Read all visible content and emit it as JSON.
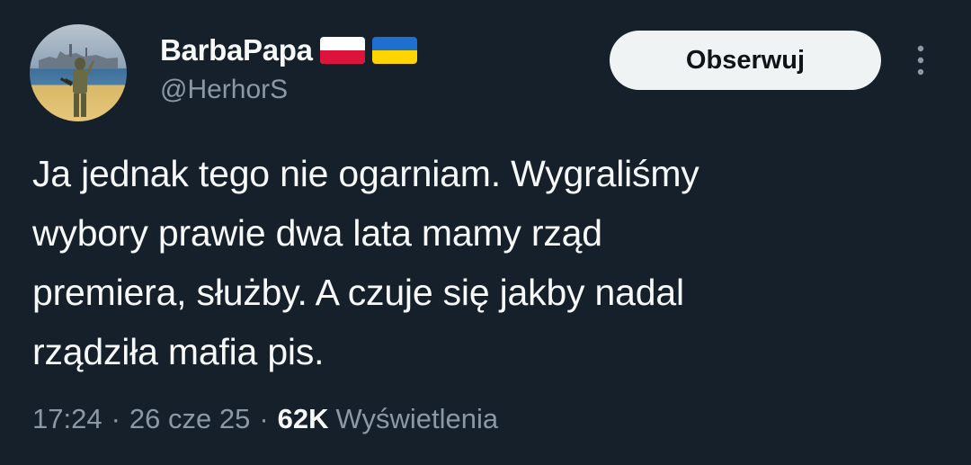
{
  "author": {
    "display_name": "BarbaPapa",
    "handle": "@HerhorS",
    "flags": [
      "poland-flag-icon",
      "ukraine-flag-icon"
    ]
  },
  "actions": {
    "follow_label": "Obserwuj",
    "more_icon": "more-vertical-icon"
  },
  "tweet": {
    "lines": [
      "Ja jednak tego nie ogarniam. Wygraliśmy",
      "wybory prawie dwa lata mamy rząd",
      "premiera, służby. A czuje się jakby nadal",
      "rządziła mafia pis."
    ]
  },
  "meta": {
    "time": "17:24",
    "separator": "·",
    "date": "26 cze 25",
    "views_count": "62K",
    "views_label": "Wyświetlenia"
  },
  "colors": {
    "background": "#15202b",
    "text_primary": "#f7f9f9",
    "text_secondary": "#8b98a5",
    "button_bg": "#eff3f4"
  }
}
